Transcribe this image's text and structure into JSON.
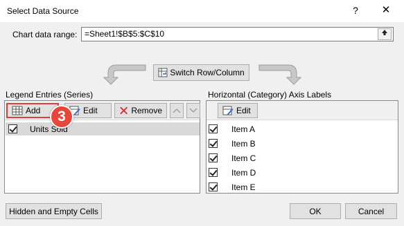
{
  "window": {
    "title": "Select Data Source",
    "help": "?",
    "close": "✕"
  },
  "range": {
    "label": "Chart data range:",
    "value": "=Sheet1!$B$5:$C$10"
  },
  "switch_button": "Switch Row/Column",
  "legend": {
    "label": "Legend Entries (Series)",
    "add": "Add",
    "edit": "Edit",
    "remove": "Remove",
    "series": [
      "Units Sold"
    ]
  },
  "axis": {
    "label": "Horizontal (Category) Axis Labels",
    "edit": "Edit",
    "items": [
      "Item A",
      "Item B",
      "Item C",
      "Item D",
      "Item E"
    ]
  },
  "badge": "3",
  "footer": {
    "hidden": "Hidden and Empty Cells",
    "ok": "OK",
    "cancel": "Cancel"
  }
}
